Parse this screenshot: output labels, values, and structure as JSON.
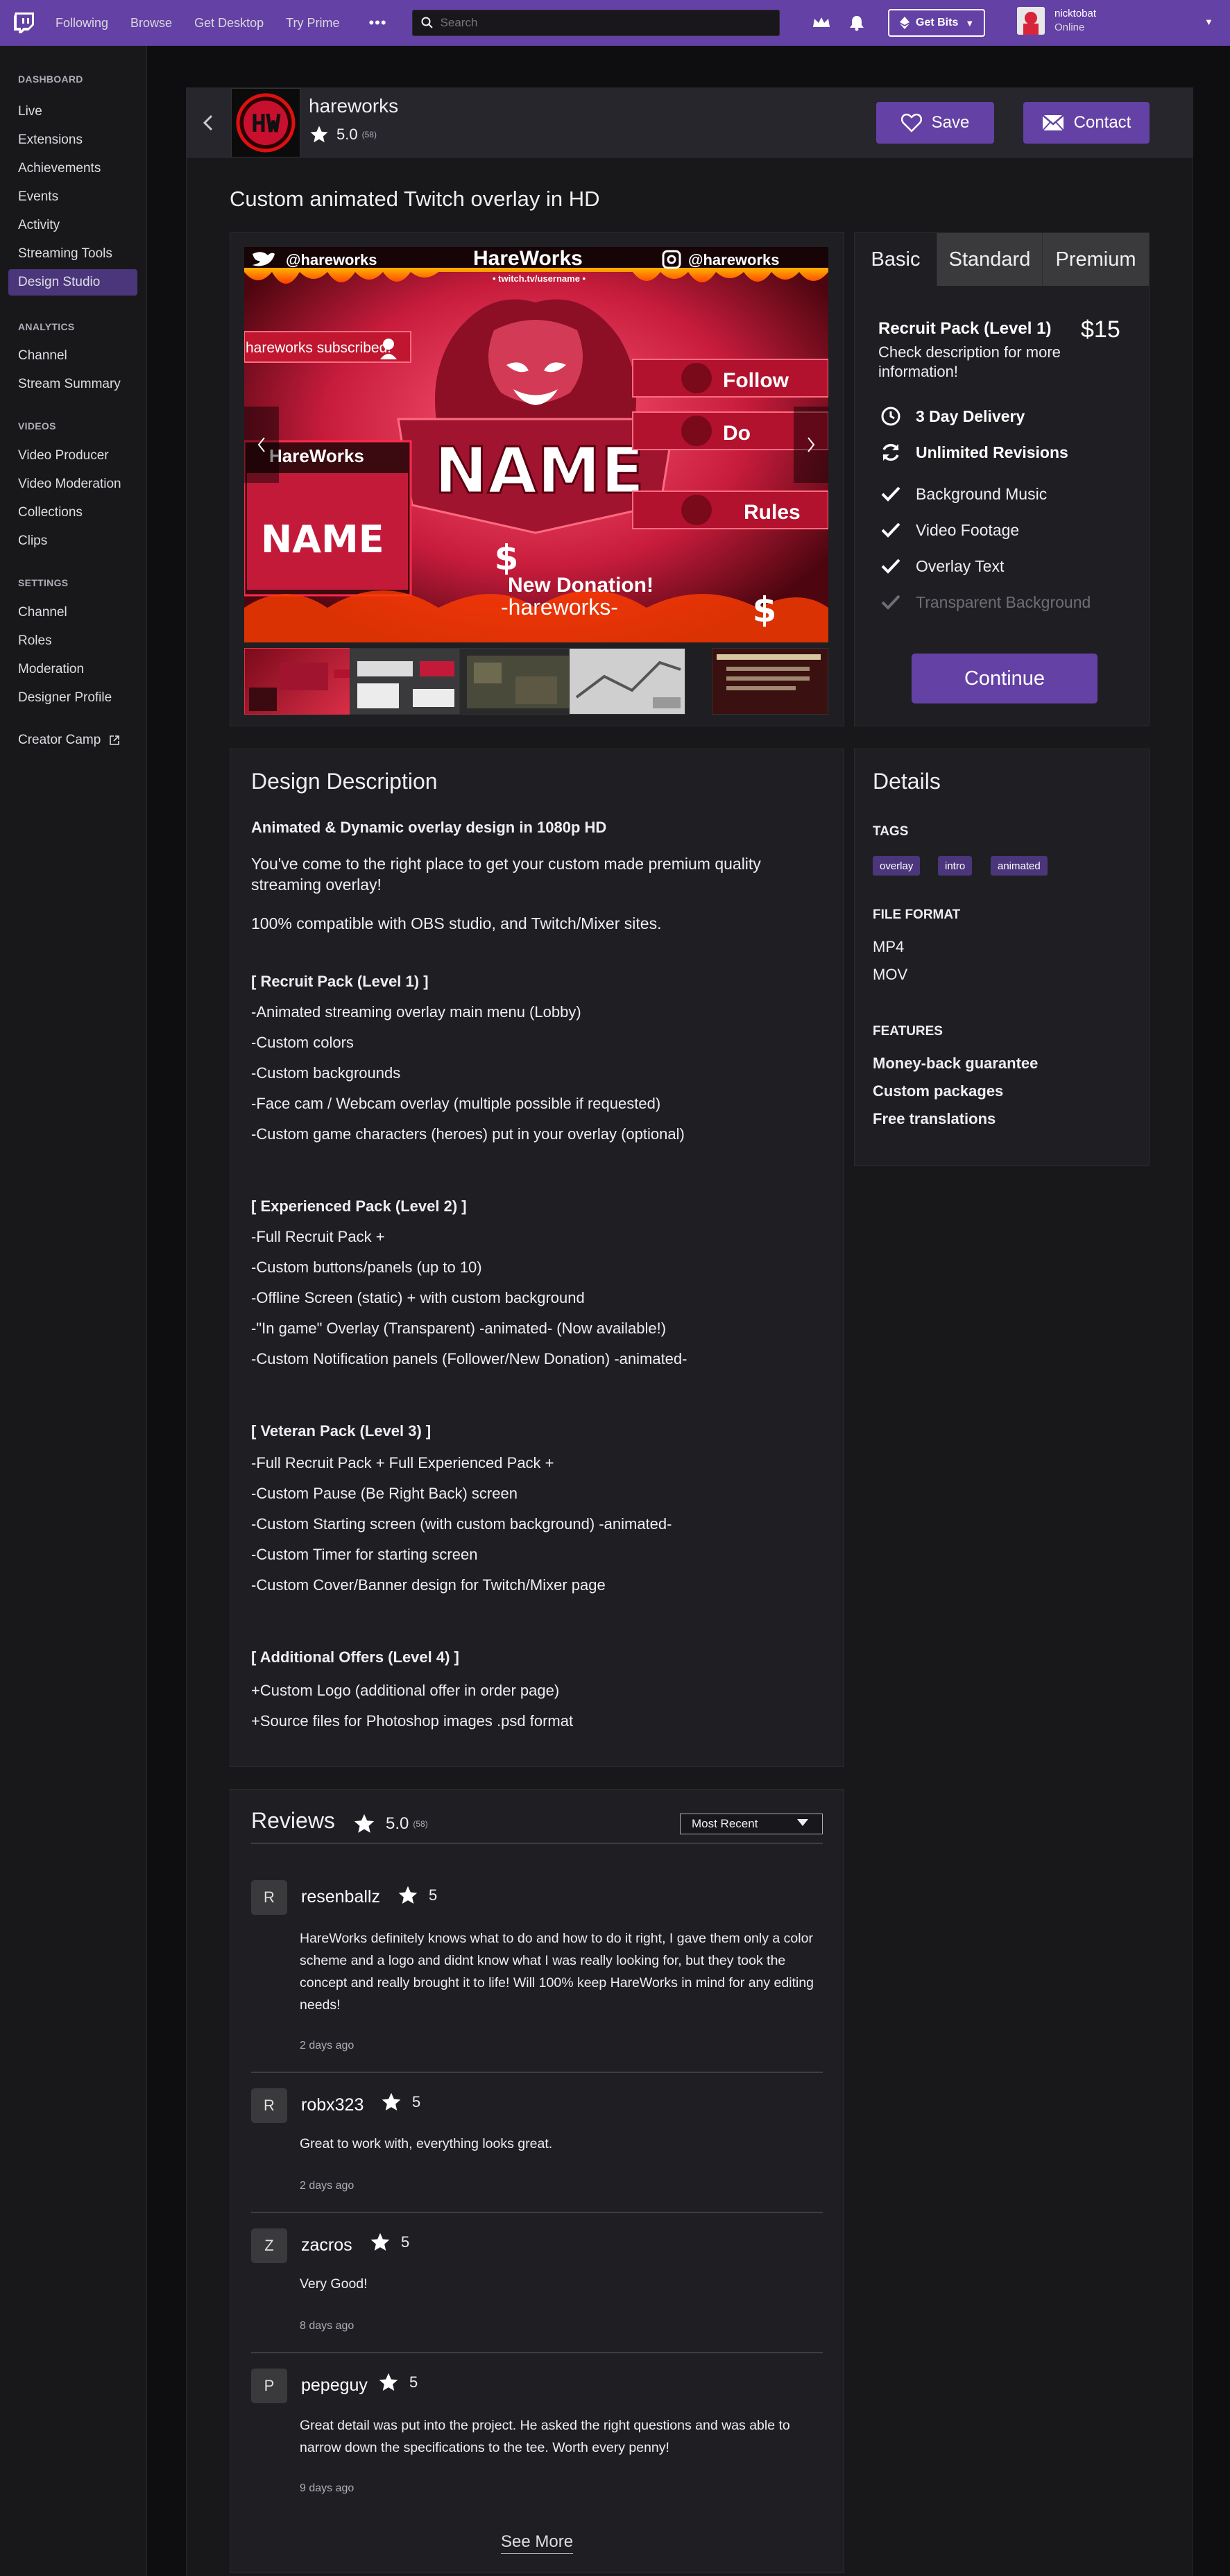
{
  "nav": {
    "links": [
      "Following",
      "Browse",
      "Get Desktop",
      "Try Prime"
    ],
    "more": "•••",
    "search_placeholder": "Search",
    "bits_label": "Get Bits",
    "user": {
      "name": "nicktobat",
      "status": "Online"
    }
  },
  "sidebar": {
    "dashboard": {
      "heading": "DASHBOARD",
      "items": [
        "Live",
        "Extensions",
        "Achievements",
        "Events",
        "Activity",
        "Streaming Tools",
        "Design Studio"
      ]
    },
    "analytics": {
      "heading": "ANALYTICS",
      "items": [
        "Channel",
        "Stream Summary"
      ]
    },
    "videos": {
      "heading": "VIDEOS",
      "items": [
        "Video Producer",
        "Video Moderation",
        "Collections",
        "Clips"
      ]
    },
    "settings": {
      "heading": "SETTINGS",
      "items": [
        "Channel",
        "Roles",
        "Moderation",
        "Designer Profile"
      ]
    },
    "creator_camp": "Creator Camp",
    "active_item": "Design Studio"
  },
  "seller": {
    "name": "hareworks",
    "rating": "5.0",
    "count": "(58)",
    "save_label": "Save",
    "contact_label": "Contact"
  },
  "gig_title": "Custom animated Twitch overlay in HD",
  "gallery": {
    "overlay_texts": {
      "twitter": "@hareworks",
      "brand": "HareWorks",
      "url": "• twitch.tv/username •",
      "instagram": "@hareworks",
      "subscribed": "hareworks subscribed!",
      "follow": "Follow",
      "donate": "Do",
      "rules": "Rules",
      "cam_brand": "HareWorks",
      "name": "NAME",
      "cam_name": "NAME",
      "donation": "New Donation!",
      "donor": "-hareworks-",
      "dollar": "$"
    }
  },
  "pricing": {
    "tabs": [
      "Basic",
      "Standard",
      "Premium"
    ],
    "active_tab": "Basic",
    "pack_name": "Recruit Pack (Level 1)",
    "price": "$15",
    "description": "Check description for more information!",
    "delivery": "3 Day Delivery",
    "revisions": "Unlimited Revisions",
    "included": [
      "Background Music",
      "Video Footage",
      "Overlay Text"
    ],
    "excluded": [
      "Transparent Background"
    ],
    "continue_label": "Continue"
  },
  "description": {
    "title": "Design Description",
    "headline": "Animated & Dynamic overlay design in 1080p HD",
    "intro": "You've come to the right place to get your custom made premium quality streaming overlay!",
    "compat": "100% compatible with OBS studio, and Twitch/Mixer sites.",
    "recruit": {
      "heading": "[ Recruit Pack (Level 1) ]",
      "items": [
        "-Animated streaming overlay main menu (Lobby)",
        "-Custom colors",
        "-Custom backgrounds",
        "-Face cam / Webcam overlay (multiple possible if requested)",
        "-Custom game characters (heroes) put in your overlay (optional)"
      ]
    },
    "experienced": {
      "heading": "[ Experienced Pack (Level 2) ]",
      "items": [
        "-Full Recruit Pack +",
        "-Custom buttons/panels (up to 10)",
        "-Offline Screen (static) + with custom background",
        "-\"In game\" Overlay (Transparent) -animated- (Now available!)",
        "-Custom Notification panels (Follower/New Donation) -animated-"
      ]
    },
    "veteran": {
      "heading": "[ Veteran Pack (Level 3) ]",
      "items": [
        "-Full Recruit Pack + Full Experienced Pack +",
        "-Custom Pause (Be Right Back) screen",
        "-Custom Starting screen (with custom background) -animated-",
        "-Custom Timer for starting screen",
        "-Custom Cover/Banner design for Twitch/Mixer page"
      ]
    },
    "additional": {
      "heading": "[ Additional Offers (Level 4) ]",
      "items": [
        "+Custom Logo (additional offer in order page)",
        "+Source files for Photoshop images .psd format"
      ]
    }
  },
  "details": {
    "title": "Details",
    "tags_label": "TAGS",
    "tags": [
      "overlay",
      "intro",
      "animated"
    ],
    "format_label": "FILE FORMAT",
    "formats": [
      "MP4",
      "MOV"
    ],
    "features_label": "FEATURES",
    "features": [
      "Money-back guarantee",
      "Custom packages",
      "Free translations"
    ]
  },
  "reviews": {
    "title": "Reviews",
    "rating": "5.0",
    "count": "(58)",
    "sort": "Most Recent",
    "items": [
      {
        "initial": "R",
        "name": "resenballz",
        "stars": "5",
        "text": "HareWorks definitely knows what to do and how to do it right, I gave them only a color scheme and a logo and didnt know what I was really looking for, but they took the concept and really brought it to life! Will 100% keep HareWorks in mind for any editing needs!",
        "date": "2 days ago"
      },
      {
        "initial": "R",
        "name": "robx323",
        "stars": "5",
        "text": "Great to work with, everything looks great.",
        "date": "2 days ago"
      },
      {
        "initial": "Z",
        "name": "zacros",
        "stars": "5",
        "text": "Very Good!",
        "date": "8 days ago"
      },
      {
        "initial": "P",
        "name": "pepeguy",
        "stars": "5",
        "text": "Great detail was put into the project. He asked the right questions and was able to narrow down the specifications to the tee. Worth every penny!",
        "date": "9 days ago"
      }
    ],
    "see_more": "See More"
  },
  "colors": {
    "brand": "#6441a4",
    "active": "#4b367c",
    "background": "#0e0e10",
    "panel": "#1f1f23"
  }
}
